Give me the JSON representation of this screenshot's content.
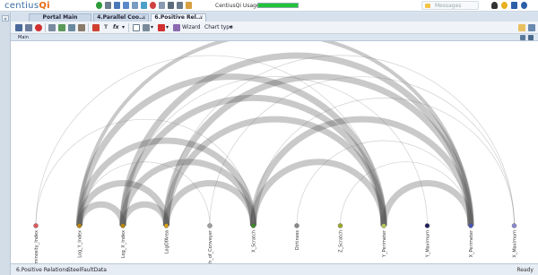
{
  "app": {
    "logo_text": "centius",
    "logo_accent": "Qi"
  },
  "topbar": {
    "usage_label": "CentiusQi Usage:",
    "usage_fraction": 1.0,
    "messages_placeholder": "Messages"
  },
  "tabs": [
    {
      "label": "Portal Main",
      "active": false,
      "closable": false
    },
    {
      "label": "4.Parallel Coo...",
      "active": false,
      "closable": true
    },
    {
      "label": "6.Positive Rel...",
      "active": true,
      "closable": true
    }
  ],
  "toolbar": {
    "fx_label": "fx",
    "wizard_label": "Wizard",
    "chart_type_label": "Chart type"
  },
  "panel": {
    "title": "Main"
  },
  "chart_data": {
    "type": "arc",
    "nodes": [
      {
        "name": "Luminosity_Index",
        "color": "#e05a5a"
      },
      {
        "name": "Log_Y_Index",
        "color": "#b8860b"
      },
      {
        "name": "Log_X_Index",
        "color": "#b8860b"
      },
      {
        "name": "LogOfArea",
        "color": "#d4a017"
      },
      {
        "name": "Length_of_Conveyer",
        "color": "#a0a0a0"
      },
      {
        "name": "X_Scratch",
        "color": "#3f8a2a"
      },
      {
        "name": "Dirtiness",
        "color": "#8a8a8a"
      },
      {
        "name": "Z_Scratch",
        "color": "#9aaa2a"
      },
      {
        "name": "Y_Perimeter",
        "color": "#b5c55a"
      },
      {
        "name": "Y_Maximum",
        "color": "#202060"
      },
      {
        "name": "X_Perimeter",
        "color": "#4a55b8"
      },
      {
        "name": "X_Maximum",
        "color": "#8a8ad0"
      }
    ],
    "links": [
      {
        "source": 1,
        "target": 2,
        "weight": 3
      },
      {
        "source": 1,
        "target": 3,
        "weight": 3
      },
      {
        "source": 1,
        "target": 5,
        "weight": 3
      },
      {
        "source": 1,
        "target": 8,
        "weight": 3
      },
      {
        "source": 1,
        "target": 10,
        "weight": 2
      },
      {
        "source": 2,
        "target": 3,
        "weight": 3
      },
      {
        "source": 2,
        "target": 5,
        "weight": 3
      },
      {
        "source": 2,
        "target": 8,
        "weight": 3
      },
      {
        "source": 2,
        "target": 10,
        "weight": 3
      },
      {
        "source": 3,
        "target": 5,
        "weight": 3
      },
      {
        "source": 3,
        "target": 8,
        "weight": 3
      },
      {
        "source": 3,
        "target": 10,
        "weight": 3
      },
      {
        "source": 5,
        "target": 8,
        "weight": 3
      },
      {
        "source": 5,
        "target": 10,
        "weight": 3
      },
      {
        "source": 8,
        "target": 10,
        "weight": 3
      },
      {
        "source": 0,
        "target": 5,
        "weight": 1
      },
      {
        "source": 0,
        "target": 8,
        "weight": 1
      },
      {
        "source": 4,
        "target": 11,
        "weight": 1
      },
      {
        "source": 6,
        "target": 10,
        "weight": 1
      },
      {
        "source": 1,
        "target": 4,
        "weight": 1
      },
      {
        "source": 3,
        "target": 11,
        "weight": 1
      },
      {
        "source": 2,
        "target": 9,
        "weight": 1
      },
      {
        "source": 7,
        "target": 10,
        "weight": 1
      },
      {
        "source": 5,
        "target": 11,
        "weight": 1
      }
    ]
  },
  "bottom": {
    "tabs": [
      "6.Positive Relations",
      "SteelFaultData"
    ],
    "status": "Ready"
  },
  "colors": {
    "accent": "#3a6ea5",
    "usage_fill": "#22c33b"
  }
}
